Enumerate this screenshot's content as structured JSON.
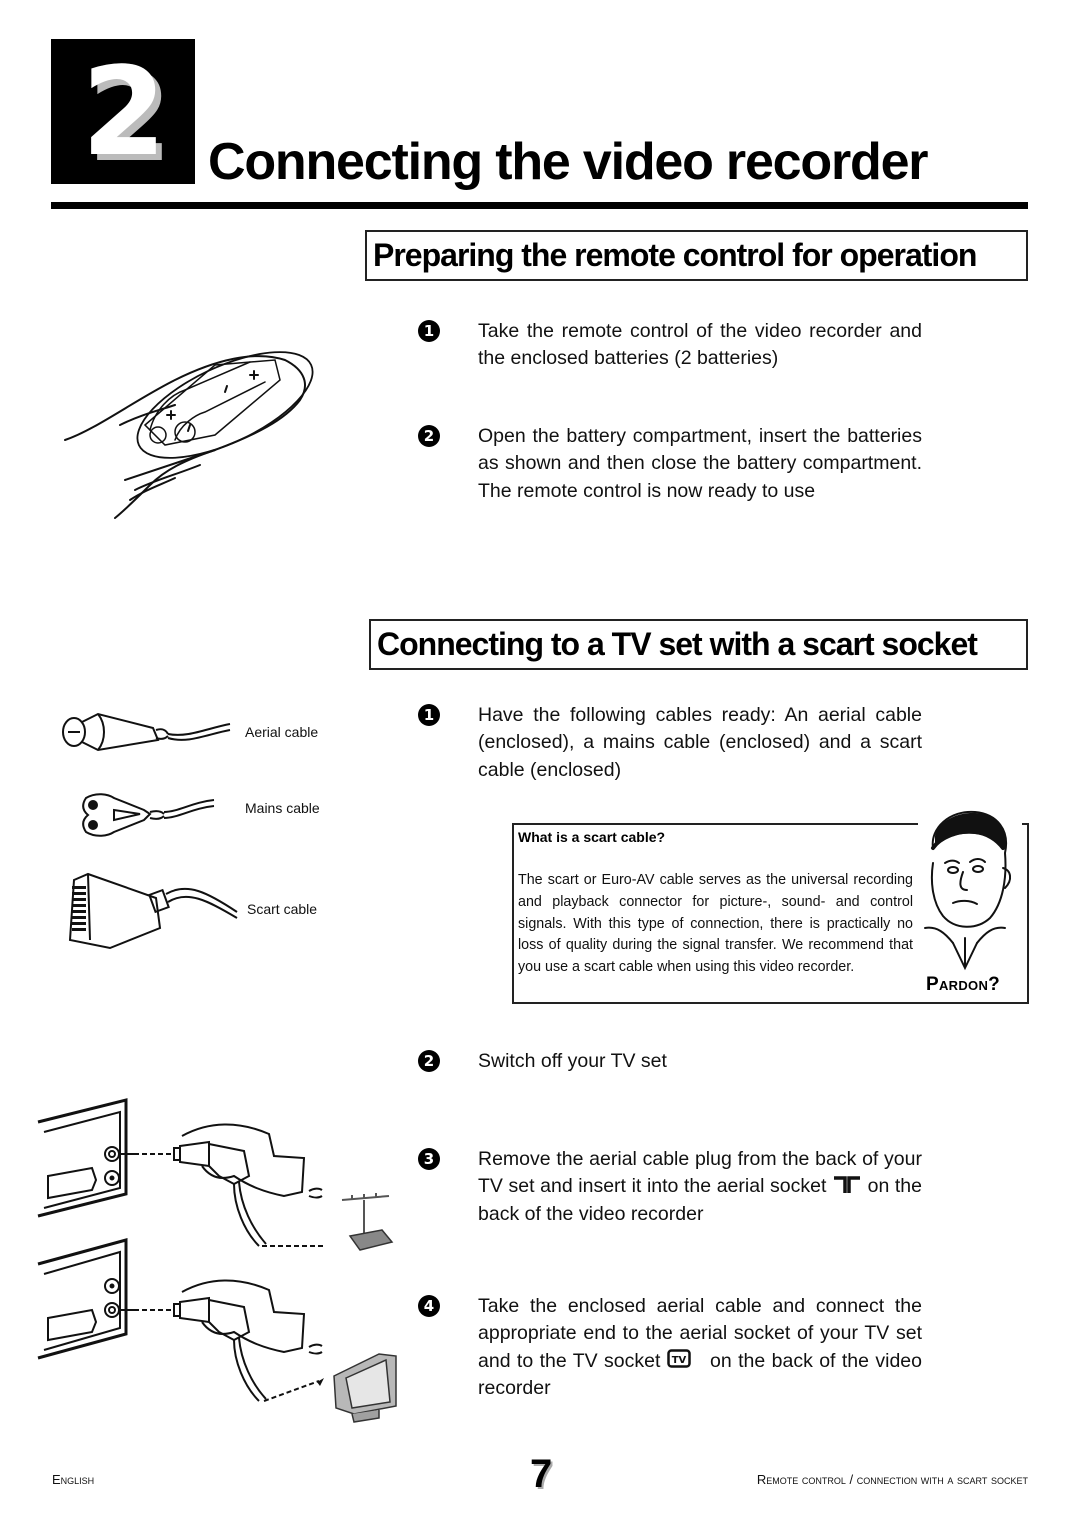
{
  "chapter": {
    "number": "2",
    "title": "Connecting the video recorder"
  },
  "section_remote": {
    "heading": "Preparing the remote control for operation",
    "steps": [
      {
        "num": "1",
        "text": "Take the remote control of the video recorder and the enclosed batteries (2 batteries)"
      },
      {
        "num": "2",
        "text": "Open the battery compartment, insert the batteries as shown and then close the battery compartment. The remote control is now ready to use"
      }
    ],
    "illustration": "remote-control-battery-compartment"
  },
  "section_scart": {
    "heading": "Connecting to a TV set with a scart socket",
    "cables": [
      {
        "label": "Aerial cable",
        "icon": "aerial-cable-icon"
      },
      {
        "label": "Mains cable",
        "icon": "mains-cable-icon"
      },
      {
        "label": "Scart cable",
        "icon": "scart-cable-icon"
      }
    ],
    "steps": [
      {
        "num": "1",
        "text": "Have the following cables ready: An aerial cable (enclosed), a mains cable (enclosed) and a scart cable (enclosed)"
      },
      {
        "num": "2",
        "text": "Switch off your TV set"
      },
      {
        "num": "3",
        "text_before": "Remove the aerial cable plug from the back of your TV set and insert it into the aerial socket",
        "icon": "aerial-socket-icon",
        "text_after": "on the back of the video recorder"
      },
      {
        "num": "4",
        "text_before": "Take the enclosed aerial cable and connect the appropriate end to the aerial socket of your TV set and to the TV socket",
        "icon": "tv-socket-icon",
        "text_after": "on the back of the video recorder"
      }
    ],
    "infobox": {
      "title": "What is a scart cable?",
      "body": "The scart or Euro-AV cable serves as the universal recording and playback connector for picture-, sound- and control signals. With this type of connection, there is practically no loss of quality during the signal transfer. We recommend that you use a scart cable when using this video recorder.",
      "mascot_caption": "Pardon?"
    },
    "socket_labels": {
      "aerial": "⊤⊤",
      "tv": "TV"
    }
  },
  "footer": {
    "language": "English",
    "page_number": "7",
    "section": "Remote control / connection with a scart socket"
  }
}
